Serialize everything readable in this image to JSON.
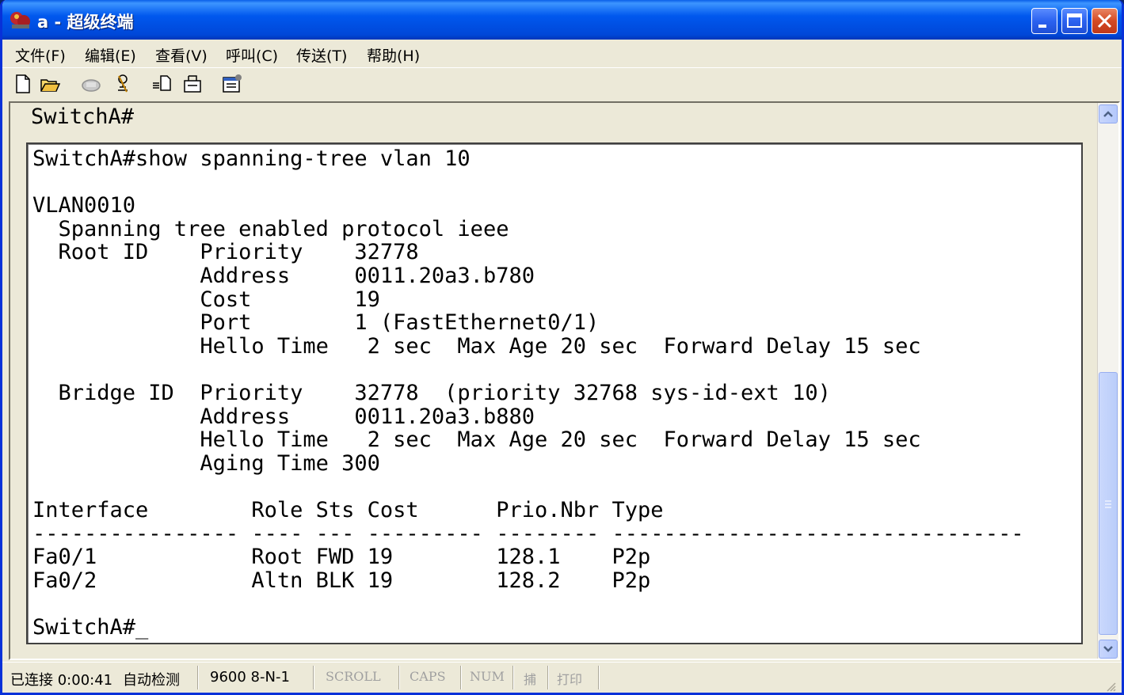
{
  "window": {
    "title": "a - 超级终端"
  },
  "menu": [
    "文件(F)",
    "编辑(E)",
    "查看(V)",
    "呼叫(C)",
    "传送(T)",
    "帮助(H)"
  ],
  "toolbar": {
    "icons": [
      "new-document-icon",
      "open-folder-icon",
      "phone-icon",
      "disconnect-icon",
      "send-file-icon",
      "receive-file-icon",
      "properties-icon"
    ]
  },
  "terminal": {
    "top_line": "SwitchA#",
    "lines": [
      "SwitchA#show spanning-tree vlan 10",
      "",
      "VLAN0010",
      "  Spanning tree enabled protocol ieee",
      "  Root ID    Priority    32778",
      "             Address     0011.20a3.b780",
      "             Cost        19",
      "             Port        1 (FastEthernet0/1)",
      "             Hello Time   2 sec  Max Age 20 sec  Forward Delay 15 sec",
      "",
      "  Bridge ID  Priority    32778  (priority 32768 sys-id-ext 10)",
      "             Address     0011.20a3.b880",
      "             Hello Time   2 sec  Max Age 20 sec  Forward Delay 15 sec",
      "             Aging Time 300",
      "",
      "Interface        Role Sts Cost      Prio.Nbr Type",
      "---------------- ---- --- --------- -------- --------------------------------",
      "Fa0/1            Root FWD 19        128.1    P2p",
      "Fa0/2            Altn BLK 19        128.2    P2p",
      "",
      "SwitchA#_"
    ]
  },
  "status": {
    "connected": "已连接 0:00:41",
    "detect": "自动检测",
    "port": "9600 8-N-1",
    "scroll": "SCROLL",
    "caps": "CAPS",
    "num": "NUM",
    "capture": "捕",
    "print": "打印"
  },
  "colors": {
    "titlebar": "#0058ee",
    "chrome": "#ece9d8",
    "close_button": "#d44a24"
  }
}
